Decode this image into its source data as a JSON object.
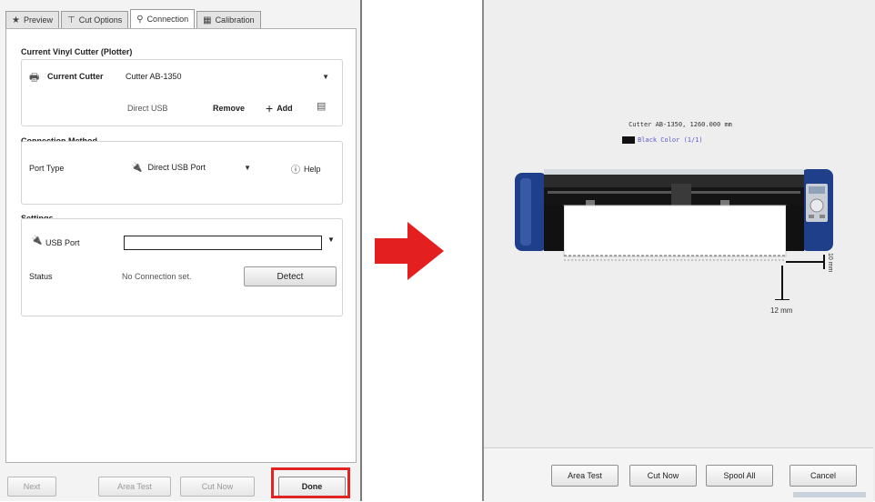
{
  "tabs": [
    {
      "icon": "preview-icon",
      "label": "Preview"
    },
    {
      "icon": "cut-options-icon",
      "label": "Cut Options"
    },
    {
      "icon": "connection-icon",
      "label": "Connection"
    },
    {
      "icon": "calibration-icon",
      "label": "Calibration"
    }
  ],
  "active_tab": "Connection",
  "cutter_section": {
    "title": "Current Vinyl Cutter (Plotter)",
    "current_cutter_label": "Current Cutter",
    "current_cutter_value": "Cutter AB-1350",
    "connection_text": "Direct USB",
    "remove_label": "Remove",
    "add_label": "Add"
  },
  "connection_method": {
    "title": "Connection Method",
    "port_type_label": "Port Type",
    "port_type_value": "Direct USB Port",
    "help_label": "Help"
  },
  "settings": {
    "title": "Settings",
    "usb_port_label": "USB Port",
    "usb_port_value": "",
    "status_label": "Status",
    "status_value": "No Connection set.",
    "detect_label": "Detect"
  },
  "left_footer": {
    "next_label": "Next",
    "area_test_label": "Area Test",
    "cut_now_label": "Cut Now",
    "done_label": "Done"
  },
  "preview": {
    "cutter_info": "Cutter AB-1350, 1260.000 mm",
    "color_label": "Black Color (1/1)",
    "dim_right": "10 mm",
    "dim_bottom": "12 mm"
  },
  "right_footer": {
    "area_test_label": "Area Test",
    "cut_now_label": "Cut Now",
    "spool_label": "Spool All",
    "cancel_label": "Cancel"
  },
  "colors": {
    "highlight": "#e02424",
    "arrow": "#e3201f",
    "cutter_body": "#1f3f8a"
  }
}
